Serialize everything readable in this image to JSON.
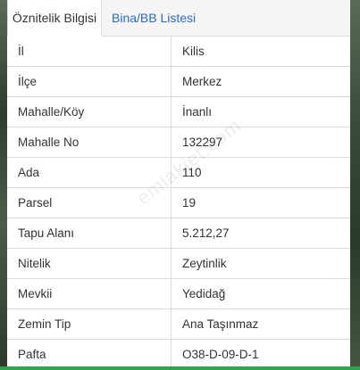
{
  "tabs": [
    {
      "label": "Öznitelik Bilgisi",
      "active": true
    },
    {
      "label": "Bina/BB Listesi",
      "active": false
    }
  ],
  "rows": [
    {
      "key": "İl",
      "value": "Kilis"
    },
    {
      "key": "İlçe",
      "value": "Merkez"
    },
    {
      "key": "Mahalle/Köy",
      "value": "İnanlı"
    },
    {
      "key": "Mahalle No",
      "value": "132297"
    },
    {
      "key": "Ada",
      "value": "110"
    },
    {
      "key": "Parsel",
      "value": "19"
    },
    {
      "key": "Tapu Alanı",
      "value": "5.212,27"
    },
    {
      "key": "Nitelik",
      "value": "Zeytinlik"
    },
    {
      "key": "Mevkii",
      "value": "Yedidağ"
    },
    {
      "key": "Zemin Tip",
      "value": "Ana Taşınmaz"
    },
    {
      "key": "Pafta",
      "value": "O38-D-09-D-1"
    }
  ],
  "watermark": "emlakjet.com",
  "colors": {
    "link": "#2a6ebb",
    "border": "#dcdcdc",
    "accent_bar": "#2fa34e"
  }
}
